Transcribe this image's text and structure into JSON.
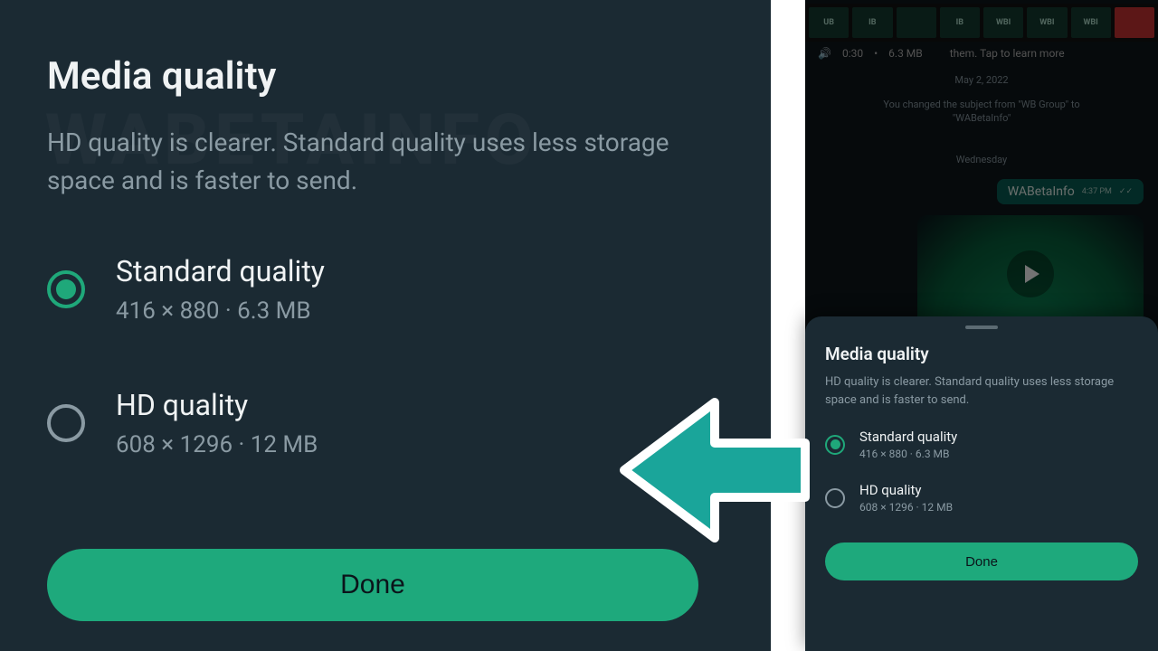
{
  "main": {
    "title": "Media quality",
    "subtitle": "HD quality is clearer. Standard quality uses less storage space and is faster to send.",
    "options": [
      {
        "label": "Standard quality",
        "detail": "416 × 880 · 6.3 MB"
      },
      {
        "label": "HD quality",
        "detail": "608 × 1296 · 12 MB"
      }
    ],
    "done": "Done",
    "watermark": "WABETAINFO"
  },
  "chat": {
    "audio_time": "0:30",
    "audio_size": "6.3 MB",
    "banner": "them. Tap to learn more",
    "date": "May 2, 2022",
    "system_msg": "You changed the subject from \"WB Group\" to \"WABetaInfo\"",
    "day": "Wednesday",
    "bubble_text": "WABetaInfo",
    "bubble_time": "4:37 PM"
  },
  "sheet": {
    "title": "Media quality",
    "subtitle": "HD quality is clearer. Standard quality uses less storage space and is faster to send.",
    "options": [
      {
        "label": "Standard quality",
        "detail": "416 × 880 · 6.3 MB"
      },
      {
        "label": "HD quality",
        "detail": "608 × 1296 · 12 MB"
      }
    ],
    "done": "Done"
  }
}
